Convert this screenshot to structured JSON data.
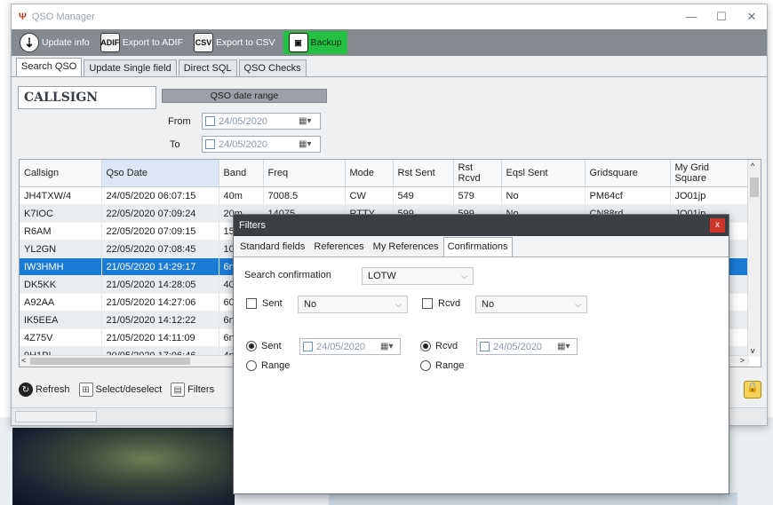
{
  "window": {
    "title": "QSO Manager",
    "minimize": "—",
    "maximize": "☐",
    "close": "✕"
  },
  "toolbar": {
    "update_info": "Update info",
    "export_adif": "Export to ADIF",
    "export_adif_icon": "ADIF",
    "export_csv": "Export to CSV",
    "export_csv_icon": "CSV",
    "backup": "Backup"
  },
  "tabs": [
    "Search QSO",
    "Update Single field",
    "Direct SQL",
    "QSO Checks"
  ],
  "search": {
    "callsign": "CALLSIGN",
    "range_header": "QSO date range",
    "from_label": "From",
    "to_label": "To",
    "from_date": "24/05/2020",
    "to_date": "24/05/2020"
  },
  "grid": {
    "columns": [
      "Callsign",
      "Qso Date",
      "Band",
      "Freq",
      "Mode",
      "Rst Sent",
      "Rst Rcvd",
      "Eqsl Sent",
      "Gridsquare",
      "My Grid Square"
    ],
    "rows": [
      [
        "JH4TXW/4",
        "24/05/2020 06:07:15",
        "40m",
        "7008.5",
        "CW",
        "549",
        "579",
        "No",
        "PM64cf",
        "JO01jp"
      ],
      [
        "K7IOC",
        "22/05/2020 07:09:24",
        "20m",
        "14075",
        "RTTY",
        "599",
        "599",
        "No",
        "CN88rd",
        "JO01jp"
      ],
      [
        "R6AM",
        "22/05/2020 07:09:15",
        "15",
        "",
        "",
        "",
        "",
        "",
        "",
        ""
      ],
      [
        "YL2GN",
        "22/05/2020 07:08:45",
        "10",
        "",
        "",
        "",
        "",
        "",
        "",
        ""
      ],
      [
        "IW3HMH",
        "21/05/2020 14:29:17",
        "6n",
        "",
        "",
        "",
        "",
        "",
        "",
        ""
      ],
      [
        "DK5KK",
        "21/05/2020 14:28:05",
        "40",
        "",
        "",
        "",
        "",
        "",
        "",
        ""
      ],
      [
        "A92AA",
        "21/05/2020 14:27:06",
        "60",
        "",
        "",
        "",
        "",
        "",
        "",
        ""
      ],
      [
        "IK5EEA",
        "21/05/2020 14:12:22",
        "6n",
        "",
        "",
        "",
        "",
        "",
        "",
        ""
      ],
      [
        "4Z75V",
        "21/05/2020 14:11:09",
        "6n",
        "",
        "",
        "",
        "",
        "",
        "",
        ""
      ],
      [
        "9H1PI",
        "20/05/2020 17:06:46",
        "4n",
        "",
        "",
        "",
        "",
        "",
        "",
        ""
      ]
    ],
    "scroll_left": "<",
    "scroll_right": ">",
    "scroll_up": "^",
    "scroll_down": "v"
  },
  "bottom": {
    "refresh": "Refresh",
    "select": "Select/deselect",
    "filters": "Filters"
  },
  "dialog": {
    "title": "Filters",
    "close": "x",
    "tabs": [
      "Standard fields",
      "References",
      "My References",
      "Confirmations"
    ],
    "search_confirmation_label": "Search confirmation",
    "search_confirmation_value": "LOTW",
    "sent_label": "Sent",
    "sent_value": "No",
    "rcvd_label": "Rcvd",
    "rcvd_value": "No",
    "sent_date": "24/05/2020",
    "rcvd_date": "24/05/2020",
    "range_label": "Range"
  },
  "colors": {
    "selection": "#1a7ad4",
    "backup_green": "#23c043",
    "toolbar": "#848a90",
    "dialog_title": "#3b3f44",
    "close_red": "#d0352b"
  }
}
